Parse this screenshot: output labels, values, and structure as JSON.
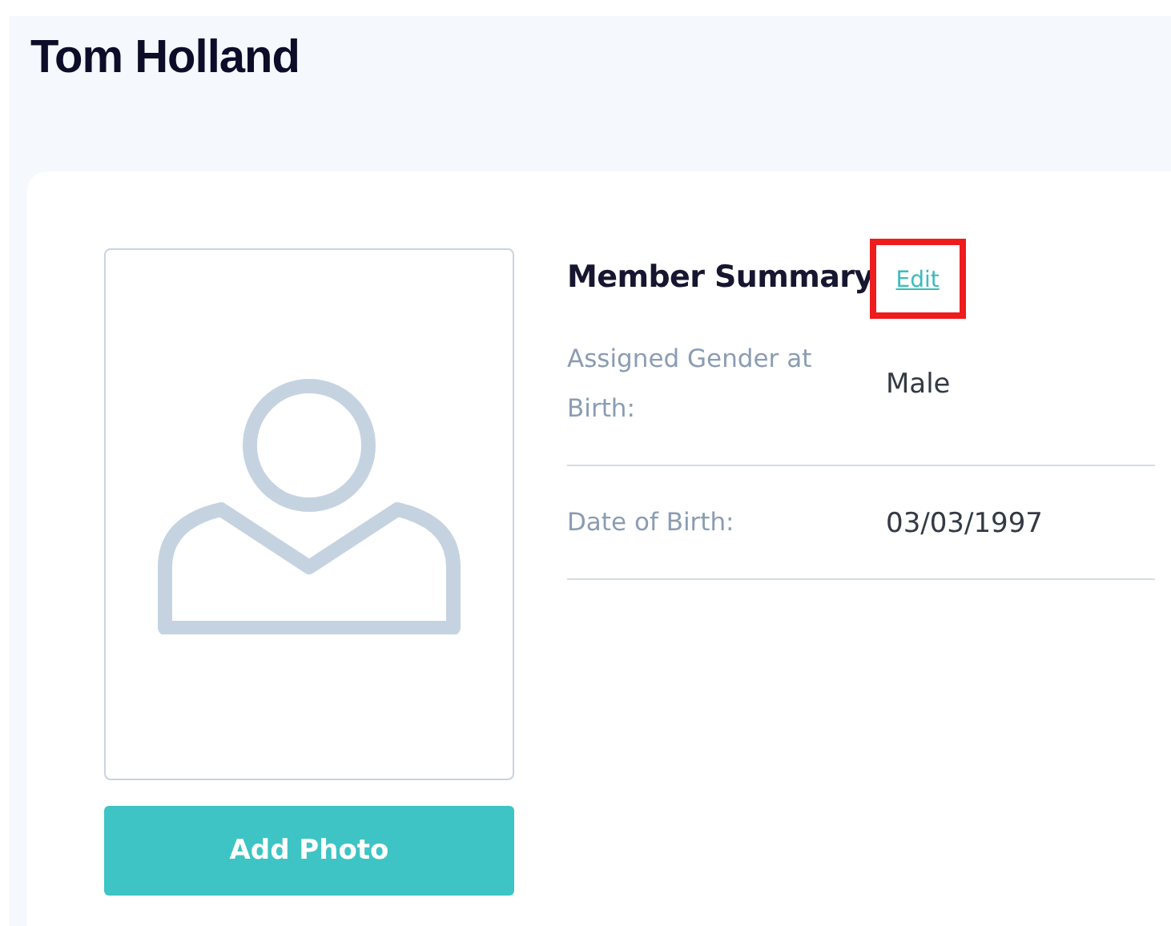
{
  "page": {
    "title": "Tom Holland"
  },
  "photo": {
    "button": "Add Photo"
  },
  "summary": {
    "heading": "Member Summary",
    "edit_link": "Edit",
    "fields": [
      {
        "label": "Assigned Gender at Birth:",
        "value": "Male"
      },
      {
        "label": "Date of Birth:",
        "value": "03/03/1997"
      }
    ]
  }
}
